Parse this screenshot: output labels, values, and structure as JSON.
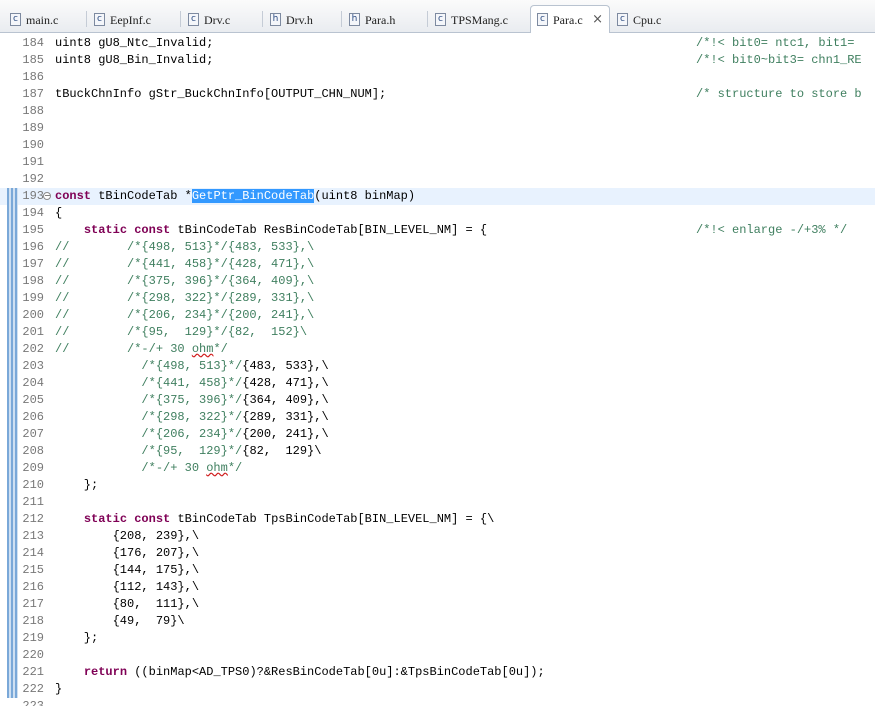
{
  "tabs": [
    {
      "label": "main.c",
      "icon": "c-source-file-icon",
      "glyph": "c",
      "active": false
    },
    {
      "label": "EepInf.c",
      "icon": "c-source-file-icon",
      "glyph": "c",
      "active": false
    },
    {
      "label": "Drv.c",
      "icon": "c-source-file-icon",
      "glyph": "c",
      "active": false
    },
    {
      "label": "Drv.h",
      "icon": "header-file-icon",
      "glyph": "h",
      "active": false
    },
    {
      "label": "Para.h",
      "icon": "header-file-icon",
      "glyph": "h",
      "active": false
    },
    {
      "label": "TPSMang.c",
      "icon": "c-source-file-icon",
      "glyph": "c",
      "active": false
    },
    {
      "label": "Para.c",
      "icon": "c-source-file-icon",
      "glyph": "c",
      "active": true,
      "close": "×"
    },
    {
      "label": "Cpu.c",
      "icon": "c-source-file-icon",
      "glyph": "c",
      "active": false
    }
  ],
  "editor": {
    "current_line": 193,
    "lines": [
      {
        "n": "184",
        "code": "uint8 gU8_Ntc_Invalid;",
        "comment": "/*!< bit0= ntc1, bit1="
      },
      {
        "n": "185",
        "code": "uint8 gU8_Bin_Invalid;",
        "comment": "/*!< bit0~bit3= chn1_RE"
      },
      {
        "n": "186",
        "code": ""
      },
      {
        "n": "187",
        "code": "tBuckChnInfo gStr_BuckChnInfo[OUTPUT_CHN_NUM];",
        "comment": "/* structure to store b"
      },
      {
        "n": "188",
        "code": ""
      },
      {
        "n": "189",
        "code": ""
      },
      {
        "n": "190",
        "code": ""
      },
      {
        "n": "191",
        "code": ""
      },
      {
        "n": "192",
        "code": ""
      },
      {
        "n": "193",
        "code": "const tBinCodeTab *GetPtr_BinCodeTab(uint8 binMap)"
      },
      {
        "n": "194",
        "code": "{"
      },
      {
        "n": "195",
        "code": "    static const tBinCodeTab ResBinCodeTab[BIN_LEVEL_NM] = {",
        "comment": "/*!< enlarge -/+3% */"
      },
      {
        "n": "196",
        "code": "//        /*{498, 513}*/{483, 533},\\"
      },
      {
        "n": "197",
        "code": "//        /*{441, 458}*/{428, 471},\\"
      },
      {
        "n": "198",
        "code": "//        /*{375, 396}*/{364, 409},\\"
      },
      {
        "n": "199",
        "code": "//        /*{298, 322}*/{289, 331},\\"
      },
      {
        "n": "200",
        "code": "//        /*{206, 234}*/{200, 241},\\"
      },
      {
        "n": "201",
        "code": "//        /*{95,  129}*/{82,  152}\\"
      },
      {
        "n": "202",
        "code": "//        /*-/+ 30 ohm*/"
      },
      {
        "n": "203",
        "code": "            /*{498, 513}*/{483, 533},\\"
      },
      {
        "n": "204",
        "code": "            /*{441, 458}*/{428, 471},\\"
      },
      {
        "n": "205",
        "code": "            /*{375, 396}*/{364, 409},\\"
      },
      {
        "n": "206",
        "code": "            /*{298, 322}*/{289, 331},\\"
      },
      {
        "n": "207",
        "code": "            /*{206, 234}*/{200, 241},\\"
      },
      {
        "n": "208",
        "code": "            /*{95,  129}*/{82,  129}\\"
      },
      {
        "n": "209",
        "code": "            /*-/+ 30 ohm*/"
      },
      {
        "n": "210",
        "code": "    };"
      },
      {
        "n": "211",
        "code": ""
      },
      {
        "n": "212",
        "code": "    static const tBinCodeTab TpsBinCodeTab[BIN_LEVEL_NM] = {\\"
      },
      {
        "n": "213",
        "code": "        {208, 239},\\"
      },
      {
        "n": "214",
        "code": "        {176, 207},\\"
      },
      {
        "n": "215",
        "code": "        {144, 175},\\"
      },
      {
        "n": "216",
        "code": "        {112, 143},\\"
      },
      {
        "n": "217",
        "code": "        {80,  111},\\"
      },
      {
        "n": "218",
        "code": "        {49,  79}\\"
      },
      {
        "n": "219",
        "code": "    };"
      },
      {
        "n": "220",
        "code": ""
      },
      {
        "n": "221",
        "code": "    return ((binMap<AD_TPS0)?&ResBinCodeTab[0u]:&TpsBinCodeTab[0u]);"
      },
      {
        "n": "222",
        "code": "}"
      },
      {
        "n": "223",
        "code": ""
      }
    ]
  }
}
